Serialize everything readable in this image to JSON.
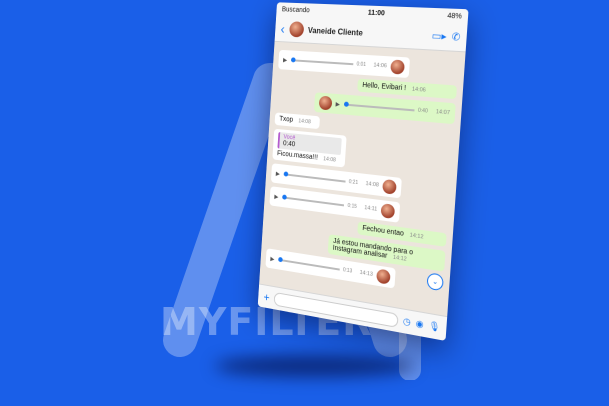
{
  "status": {
    "carrier": "Buscando",
    "time": "11:00",
    "battery": "48%"
  },
  "chat": {
    "contact_name": "Vaneide Cliente",
    "messages": [
      {
        "kind": "audio-in",
        "duration": "0:01",
        "time": "14:06"
      },
      {
        "kind": "text-out",
        "text": "Hello, Evibari !",
        "time": "14:06"
      },
      {
        "kind": "audio-out",
        "duration": "0:40",
        "time": "14:07"
      },
      {
        "kind": "text-in",
        "text": "Txop",
        "time": "14:08"
      },
      {
        "kind": "reply-in",
        "quote_author": "Você",
        "quote_text": "0:40",
        "text": "Ficou.massa!!!",
        "time": "14:08"
      },
      {
        "kind": "audio-in",
        "duration": "0:21",
        "time": "14:08"
      },
      {
        "kind": "audio-in",
        "duration": "0:15",
        "time": "14:11"
      },
      {
        "kind": "text-out",
        "text": "Fechou entao",
        "time": "14:12"
      },
      {
        "kind": "text-out",
        "text": "Já estou mandando para o Instagram analisar",
        "time": "14:12"
      },
      {
        "kind": "audio-in",
        "duration": "0:13",
        "time": "14:13"
      }
    ]
  },
  "brand": {
    "name": "MYFILTER"
  },
  "colors": {
    "background": "#1a5fe8",
    "accent": "#1877f2",
    "outgoing": "#dcf8c6"
  }
}
